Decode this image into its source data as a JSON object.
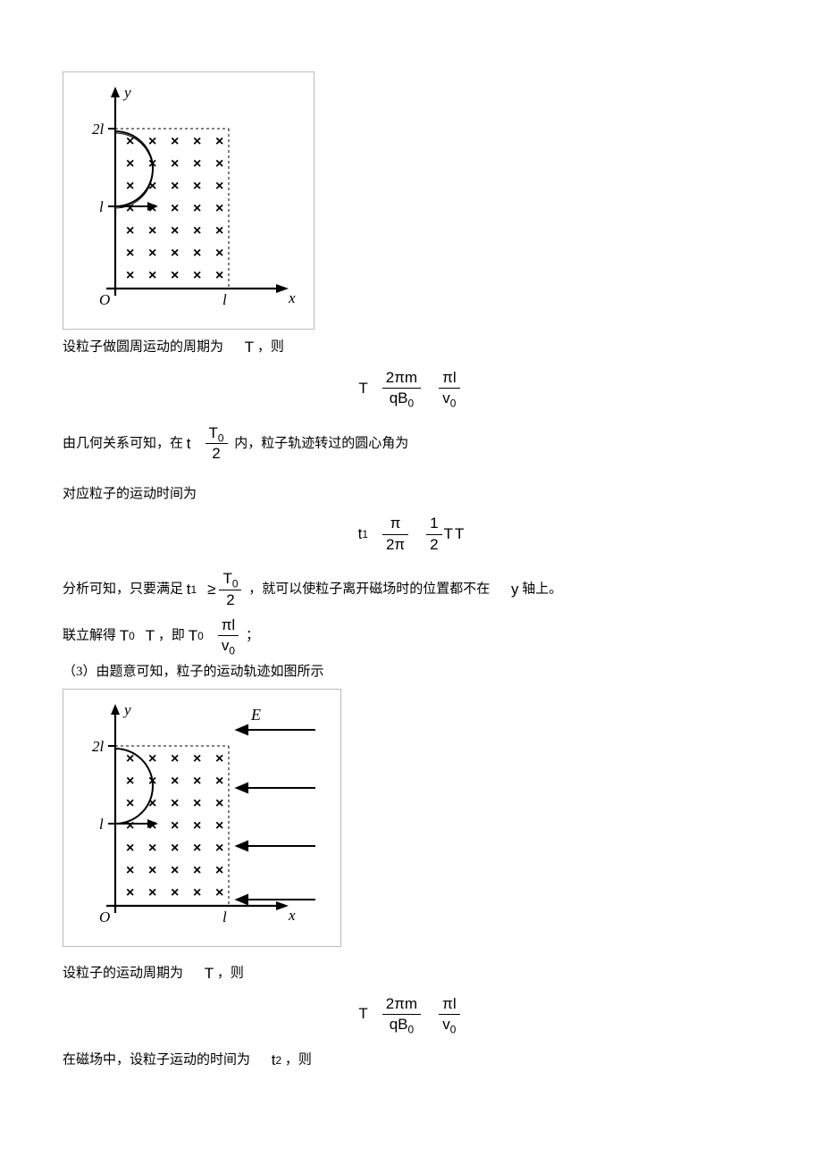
{
  "figure1": {
    "yLabel": "y",
    "ytick1": "2l",
    "ytick2": "l",
    "origin": "O",
    "xtick": "l",
    "xLabel": "x"
  },
  "p1": {
    "text_pre": "设粒子做圆周运动的周期为",
    "sym": "T",
    "text_post": "，则"
  },
  "eq1": {
    "lhs": "T",
    "frac1_num": "2πm",
    "frac1_den": "qB",
    "frac1_den_sub": "0",
    "frac2_num": "πl",
    "frac2_den": "v",
    "frac2_den_sub": "0"
  },
  "p2": {
    "pre": "由几何关系可知，在",
    "sym_t": "t",
    "frac_num": "T",
    "frac_num_sub": "0",
    "frac_den": "2",
    "post": "内，粒子轨迹转过的圆心角为"
  },
  "p3": {
    "text": "对应粒子的运动时间为"
  },
  "eq2": {
    "lhs": "t",
    "lhs_sub": "1",
    "frac1_num": "π",
    "frac1_den": "2π",
    "frac2_num": "1",
    "frac2_den": "2",
    "tail": "T"
  },
  "p4": {
    "pre": "分析可知，只要满足",
    "sym_t1": "t",
    "sym_t1_sub": "1",
    "ge": "≥",
    "frac_num": "T",
    "frac_num_sub": "0",
    "frac_den": "2",
    "mid": "，就可以使粒子离开磁场时的位置都不在",
    "sym_y": "y",
    "post": "轴上。"
  },
  "p5": {
    "pre": "联立解得",
    "T0": "T",
    "T0_sub": "0",
    "le": "≤",
    "T": "T",
    "ie": "，即",
    "T0b": "T",
    "T0b_sub": "0",
    "frac_num": "πl",
    "frac_den": "v",
    "frac_den_sub": "0",
    "end": "；"
  },
  "p6": {
    "text": "（3）由题意可知，粒子的运动轨迹如图所示"
  },
  "figure2": {
    "yLabel": "y",
    "E": "E",
    "ytick1": "2l",
    "ytick2": "l",
    "origin": "O",
    "xtick": "l",
    "xLabel": "x"
  },
  "p7": {
    "pre": "设粒子的运动周期为",
    "sym": "T",
    "post": "，则"
  },
  "eq3": {
    "lhs": "T",
    "frac1_num": "2πm",
    "frac1_den": "qB",
    "frac1_den_sub": "0",
    "frac2_num": "πl",
    "frac2_den": "v",
    "frac2_den_sub": "0"
  },
  "p8": {
    "pre": "在磁场中，设粒子运动的时间为",
    "sym": "t",
    "sym_sub": "2",
    "post": "，则"
  }
}
